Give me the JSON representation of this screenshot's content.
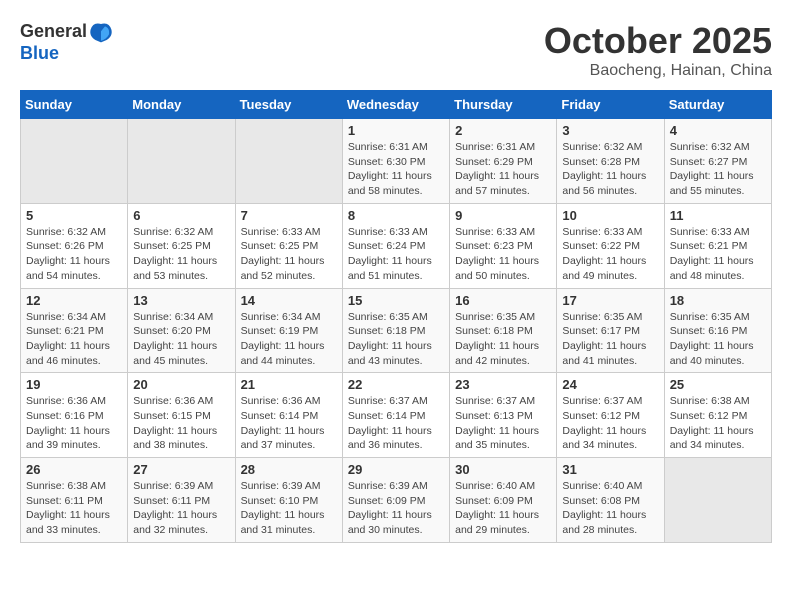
{
  "header": {
    "logo_line1": "General",
    "logo_line2": "Blue",
    "month_title": "October 2025",
    "location": "Baocheng, Hainan, China"
  },
  "weekdays": [
    "Sunday",
    "Monday",
    "Tuesday",
    "Wednesday",
    "Thursday",
    "Friday",
    "Saturday"
  ],
  "weeks": [
    [
      {
        "day": "",
        "sunrise": "",
        "sunset": "",
        "daylight": ""
      },
      {
        "day": "",
        "sunrise": "",
        "sunset": "",
        "daylight": ""
      },
      {
        "day": "",
        "sunrise": "",
        "sunset": "",
        "daylight": ""
      },
      {
        "day": "1",
        "sunrise": "Sunrise: 6:31 AM",
        "sunset": "Sunset: 6:30 PM",
        "daylight": "Daylight: 11 hours and 58 minutes."
      },
      {
        "day": "2",
        "sunrise": "Sunrise: 6:31 AM",
        "sunset": "Sunset: 6:29 PM",
        "daylight": "Daylight: 11 hours and 57 minutes."
      },
      {
        "day": "3",
        "sunrise": "Sunrise: 6:32 AM",
        "sunset": "Sunset: 6:28 PM",
        "daylight": "Daylight: 11 hours and 56 minutes."
      },
      {
        "day": "4",
        "sunrise": "Sunrise: 6:32 AM",
        "sunset": "Sunset: 6:27 PM",
        "daylight": "Daylight: 11 hours and 55 minutes."
      }
    ],
    [
      {
        "day": "5",
        "sunrise": "Sunrise: 6:32 AM",
        "sunset": "Sunset: 6:26 PM",
        "daylight": "Daylight: 11 hours and 54 minutes."
      },
      {
        "day": "6",
        "sunrise": "Sunrise: 6:32 AM",
        "sunset": "Sunset: 6:25 PM",
        "daylight": "Daylight: 11 hours and 53 minutes."
      },
      {
        "day": "7",
        "sunrise": "Sunrise: 6:33 AM",
        "sunset": "Sunset: 6:25 PM",
        "daylight": "Daylight: 11 hours and 52 minutes."
      },
      {
        "day": "8",
        "sunrise": "Sunrise: 6:33 AM",
        "sunset": "Sunset: 6:24 PM",
        "daylight": "Daylight: 11 hours and 51 minutes."
      },
      {
        "day": "9",
        "sunrise": "Sunrise: 6:33 AM",
        "sunset": "Sunset: 6:23 PM",
        "daylight": "Daylight: 11 hours and 50 minutes."
      },
      {
        "day": "10",
        "sunrise": "Sunrise: 6:33 AM",
        "sunset": "Sunset: 6:22 PM",
        "daylight": "Daylight: 11 hours and 49 minutes."
      },
      {
        "day": "11",
        "sunrise": "Sunrise: 6:33 AM",
        "sunset": "Sunset: 6:21 PM",
        "daylight": "Daylight: 11 hours and 48 minutes."
      }
    ],
    [
      {
        "day": "12",
        "sunrise": "Sunrise: 6:34 AM",
        "sunset": "Sunset: 6:21 PM",
        "daylight": "Daylight: 11 hours and 46 minutes."
      },
      {
        "day": "13",
        "sunrise": "Sunrise: 6:34 AM",
        "sunset": "Sunset: 6:20 PM",
        "daylight": "Daylight: 11 hours and 45 minutes."
      },
      {
        "day": "14",
        "sunrise": "Sunrise: 6:34 AM",
        "sunset": "Sunset: 6:19 PM",
        "daylight": "Daylight: 11 hours and 44 minutes."
      },
      {
        "day": "15",
        "sunrise": "Sunrise: 6:35 AM",
        "sunset": "Sunset: 6:18 PM",
        "daylight": "Daylight: 11 hours and 43 minutes."
      },
      {
        "day": "16",
        "sunrise": "Sunrise: 6:35 AM",
        "sunset": "Sunset: 6:18 PM",
        "daylight": "Daylight: 11 hours and 42 minutes."
      },
      {
        "day": "17",
        "sunrise": "Sunrise: 6:35 AM",
        "sunset": "Sunset: 6:17 PM",
        "daylight": "Daylight: 11 hours and 41 minutes."
      },
      {
        "day": "18",
        "sunrise": "Sunrise: 6:35 AM",
        "sunset": "Sunset: 6:16 PM",
        "daylight": "Daylight: 11 hours and 40 minutes."
      }
    ],
    [
      {
        "day": "19",
        "sunrise": "Sunrise: 6:36 AM",
        "sunset": "Sunset: 6:16 PM",
        "daylight": "Daylight: 11 hours and 39 minutes."
      },
      {
        "day": "20",
        "sunrise": "Sunrise: 6:36 AM",
        "sunset": "Sunset: 6:15 PM",
        "daylight": "Daylight: 11 hours and 38 minutes."
      },
      {
        "day": "21",
        "sunrise": "Sunrise: 6:36 AM",
        "sunset": "Sunset: 6:14 PM",
        "daylight": "Daylight: 11 hours and 37 minutes."
      },
      {
        "day": "22",
        "sunrise": "Sunrise: 6:37 AM",
        "sunset": "Sunset: 6:14 PM",
        "daylight": "Daylight: 11 hours and 36 minutes."
      },
      {
        "day": "23",
        "sunrise": "Sunrise: 6:37 AM",
        "sunset": "Sunset: 6:13 PM",
        "daylight": "Daylight: 11 hours and 35 minutes."
      },
      {
        "day": "24",
        "sunrise": "Sunrise: 6:37 AM",
        "sunset": "Sunset: 6:12 PM",
        "daylight": "Daylight: 11 hours and 34 minutes."
      },
      {
        "day": "25",
        "sunrise": "Sunrise: 6:38 AM",
        "sunset": "Sunset: 6:12 PM",
        "daylight": "Daylight: 11 hours and 34 minutes."
      }
    ],
    [
      {
        "day": "26",
        "sunrise": "Sunrise: 6:38 AM",
        "sunset": "Sunset: 6:11 PM",
        "daylight": "Daylight: 11 hours and 33 minutes."
      },
      {
        "day": "27",
        "sunrise": "Sunrise: 6:39 AM",
        "sunset": "Sunset: 6:11 PM",
        "daylight": "Daylight: 11 hours and 32 minutes."
      },
      {
        "day": "28",
        "sunrise": "Sunrise: 6:39 AM",
        "sunset": "Sunset: 6:10 PM",
        "daylight": "Daylight: 11 hours and 31 minutes."
      },
      {
        "day": "29",
        "sunrise": "Sunrise: 6:39 AM",
        "sunset": "Sunset: 6:09 PM",
        "daylight": "Daylight: 11 hours and 30 minutes."
      },
      {
        "day": "30",
        "sunrise": "Sunrise: 6:40 AM",
        "sunset": "Sunset: 6:09 PM",
        "daylight": "Daylight: 11 hours and 29 minutes."
      },
      {
        "day": "31",
        "sunrise": "Sunrise: 6:40 AM",
        "sunset": "Sunset: 6:08 PM",
        "daylight": "Daylight: 11 hours and 28 minutes."
      },
      {
        "day": "",
        "sunrise": "",
        "sunset": "",
        "daylight": ""
      }
    ]
  ]
}
